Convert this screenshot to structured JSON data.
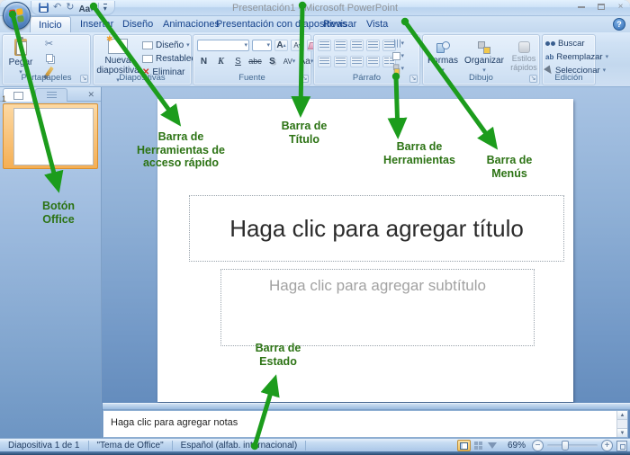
{
  "titlebar": {
    "title": "Presentación1 - Microsoft PowerPoint",
    "help": "?"
  },
  "quick_access": {
    "font_label": "Aa"
  },
  "tabs": {
    "items": [
      "Inicio",
      "Insertar",
      "Diseño",
      "Animaciones",
      "Presentación con diapositivas",
      "Revisar",
      "Vista"
    ],
    "active": "Inicio"
  },
  "ribbon": {
    "groups": {
      "clipboard": {
        "label": "Portapapeles",
        "paste": "Pegar"
      },
      "slides": {
        "label": "Diapositivas",
        "new_slide": "Nueva diapositiva",
        "layout": "Diseño",
        "reset": "Restablecer",
        "remove": "Eliminar"
      },
      "font": {
        "label": "Fuente",
        "bold": "N",
        "italic": "K",
        "underline": "S",
        "strikethrough": "abc",
        "shadow": "S",
        "char_spacing": "AV",
        "change_case": "Aa",
        "font_color": "A",
        "grow_font": "A",
        "shrink_font": "A"
      },
      "paragraph": {
        "label": "Párrafo"
      },
      "drawing": {
        "label": "Dibujo",
        "shapes": "Formas",
        "arrange": "Organizar",
        "quick_styles": "Estilos rápidos"
      },
      "editing": {
        "label": "Edición",
        "find": "Buscar",
        "replace": "Reemplazar",
        "select": "Seleccionar"
      }
    }
  },
  "slide_panel": {
    "slide_number": "1"
  },
  "slide": {
    "title_placeholder": "Haga clic para agregar título",
    "subtitle_placeholder": "Haga clic para agregar subtítulo"
  },
  "notes": {
    "placeholder": "Haga clic para agregar notas"
  },
  "status_bar": {
    "slide_indicator": "Diapositiva 1 de 1",
    "theme": "\"Tema de Office\"",
    "language": "Español (alfab. internacional)",
    "zoom_level": "69%"
  },
  "annotations": {
    "office_button": "Botón\nOffice",
    "quick_access": "Barra de\nHerramientas de\nacceso rápido",
    "title_bar": "Barra de\nTítulo",
    "toolbar": "Barra de\nHerramientas",
    "menu_bar": "Barra de\nMenús",
    "status_bar": "Barra de\nEstado"
  },
  "colors": {
    "arrow_green": "#1c9c1c",
    "label_green": "#2c7314",
    "selection_orange": "#f5af54",
    "ribbon_blue": "#c3d8ee"
  }
}
